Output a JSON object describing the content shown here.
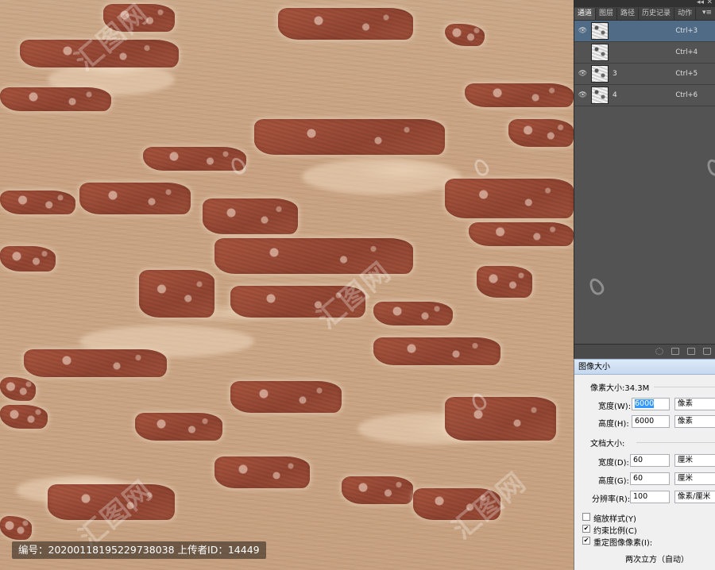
{
  "canvas": {
    "watermark_text": "汇图网",
    "caption": "编号：20200118195229738038 上传者ID：14449"
  },
  "panel": {
    "tabs": [
      {
        "label": "通道",
        "active": true
      },
      {
        "label": "图层",
        "active": false
      },
      {
        "label": "路径",
        "active": false
      },
      {
        "label": "历史记录",
        "active": false
      },
      {
        "label": "动作",
        "active": false
      }
    ],
    "channels": [
      {
        "name": "",
        "shortcut": "Ctrl+3",
        "selected": true
      },
      {
        "name": "",
        "shortcut": "Ctrl+4",
        "selected": false
      },
      {
        "name": "3",
        "shortcut": "Ctrl+5",
        "selected": false
      },
      {
        "name": "4",
        "shortcut": "Ctrl+6",
        "selected": false
      }
    ]
  },
  "dialog": {
    "title": "图像大小",
    "pixel_size": "像素大小:34.3M",
    "width_label": "宽度(W):",
    "width_value": "6000",
    "width_unit": "像素",
    "height_label": "高度(H):",
    "height_value": "6000",
    "height_unit": "像素",
    "doc_size_label": "文档大小:",
    "doc_width_label": "宽度(D):",
    "doc_width_value": "60",
    "doc_width_unit": "厘米",
    "doc_height_label": "高度(G):",
    "doc_height_value": "60",
    "doc_height_unit": "厘米",
    "resolution_label": "分辨率(R):",
    "resolution_value": "100",
    "resolution_unit": "像素/厘米",
    "scale_styles": "缩放样式(Y)",
    "constrain": "约束比例(C)",
    "resample": "重定图像像素(I):",
    "resample_method": "两次立方（自动）",
    "colors": {
      "title_bg": "#c6d9f0",
      "selection": "#3399ff"
    }
  }
}
